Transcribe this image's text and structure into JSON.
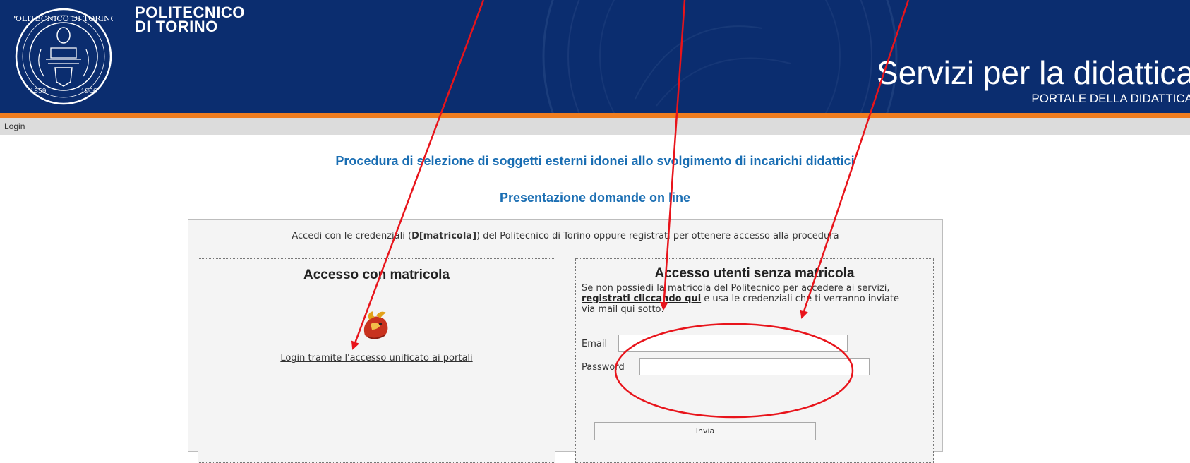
{
  "header": {
    "brand_line1": "POLITECNICO",
    "brand_line2": "DI TORINO",
    "service_title": "Servizi per la didattica",
    "service_subtitle": "PORTALE DELLA DIDATTICA",
    "seal_text": "POLITECNICO DI TORINO",
    "seal_year_left": "1859",
    "seal_year_right": "1906",
    "colors": {
      "background": "#0b2d6f",
      "accent_bar": "#ef7d1f"
    }
  },
  "breadcrumb": {
    "label": "Login"
  },
  "procedure": {
    "title": "Procedura di selezione di soggetti esterni idonei allo svolgimento di incarichi didattici",
    "subtitle": "Presentazione domande on line",
    "color": "#1a6eb3"
  },
  "login_panel": {
    "intro_prefix": "Accedi con le credenziali (",
    "intro_bold": "D[matricola]",
    "intro_suffix": ") del Politecnico di Torino oppure registrati per ottenere accesso alla procedura"
  },
  "matricola_box": {
    "title": "Accesso con matricola",
    "icon": "griffin-mascot-icon",
    "link_label": "Login tramite l'accesso unificato ai portali"
  },
  "external_box": {
    "title": "Accesso utenti senza matricola",
    "info_before": "Se non possiedi la matricola del Politecnico per accedere ai servizi, ",
    "register_link": "registrati cliccando qui",
    "info_after": " e usa le credenziali che ti verranno inviate via mail qui sotto:",
    "email_label": "Email",
    "email_value": "",
    "password_label": "Password",
    "password_value": "",
    "submit_label": "Invia"
  },
  "annotation": {
    "color": "#e8141b",
    "shapes": [
      "arrow",
      "arrow",
      "arrow",
      "ellipse"
    ]
  }
}
